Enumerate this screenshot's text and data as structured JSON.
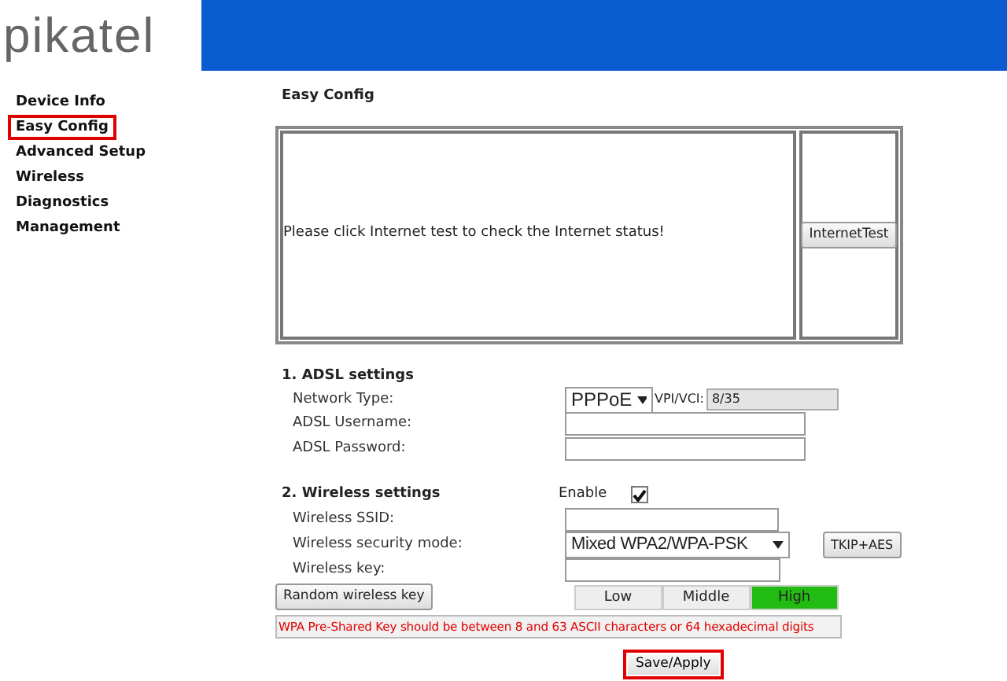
{
  "logo": "pikatel",
  "sidebar": {
    "items": [
      {
        "label": "Device Info",
        "selected": false
      },
      {
        "label": "Easy Config",
        "selected": true
      },
      {
        "label": "Advanced Setup",
        "selected": false
      },
      {
        "label": "Wireless",
        "selected": false
      },
      {
        "label": "Diagnostics",
        "selected": false
      },
      {
        "label": "Management",
        "selected": false
      }
    ]
  },
  "page_title": "Easy Config",
  "status_message": "Please click Internet test to check the Internet status!",
  "internet_test_button": "InternetTest",
  "adsl": {
    "heading": "1. ADSL settings",
    "network_type": {
      "label": "Network Type:",
      "value": "PPPoE",
      "vpi_label": "VPI/VCI:",
      "vpi_value": "8/35"
    },
    "username": {
      "label": "ADSL Username:"
    },
    "password": {
      "label": "ADSL Password:"
    }
  },
  "wireless": {
    "heading": "2. Wireless settings",
    "enable_label": "Enable",
    "enabled": true,
    "ssid": {
      "label": "Wireless SSID:"
    },
    "security_mode": {
      "label": "Wireless security mode:",
      "value": "Mixed WPA2/WPA-PSK",
      "cipher_button": "TKIP+AES"
    },
    "key": {
      "label": "Wireless key:"
    },
    "random_key_button": "Random wireless key",
    "strength": [
      {
        "label": "Low",
        "selected": false
      },
      {
        "label": "Middle",
        "selected": false
      },
      {
        "label": "High",
        "selected": true
      }
    ],
    "error": "WPA Pre-Shared Key should be between 8 and 63 ASCII characters or 64 hexadecimal digits"
  },
  "save_button": {
    "label": "Save/Apply",
    "highlighted": true
  }
}
